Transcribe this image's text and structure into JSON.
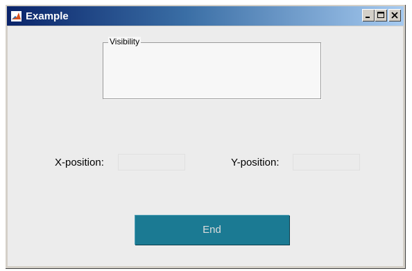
{
  "window": {
    "title": "Example",
    "controls": [
      "minimize",
      "maximize",
      "close"
    ]
  },
  "panel": {
    "title": "Visibility"
  },
  "position": {
    "x_label": "X-position:",
    "x_value": "",
    "y_label": "Y-position:",
    "y_value": ""
  },
  "actions": {
    "end_label": "End"
  },
  "colors": {
    "title_gradient_start": "#0a246a",
    "title_gradient_end": "#a6caf0",
    "end_button": "#1b7a93"
  },
  "icons": {
    "app": "matlab-logo-icon",
    "minimize": "minimize-icon",
    "maximize": "maximize-icon",
    "close": "close-icon"
  }
}
